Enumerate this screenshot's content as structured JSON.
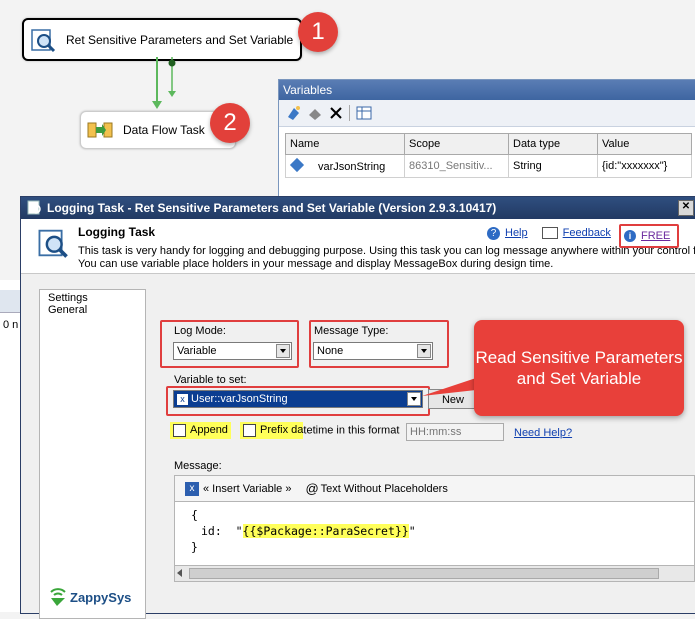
{
  "canvas": {
    "task1_label": "Ret Sensitive Parameters and Set Variable",
    "task2_label": "Data Flow Task",
    "badge1": "1",
    "badge2": "2"
  },
  "variables_window": {
    "title": "Variables",
    "columns": [
      "Name",
      "Scope",
      "Data type",
      "Value"
    ],
    "row": {
      "name": "varJsonString",
      "scope": "86310_Sensitiv...",
      "type": "String",
      "value": "{id:\"xxxxxxx\"}"
    }
  },
  "left_fragment": {
    "text": "0 n"
  },
  "dialog": {
    "title": "Logging Task - Ret Sensitive Parameters and Set Variable (Version 2.9.3.10417)",
    "header": {
      "heading": "Logging Task",
      "desc1": "This task is very handy for logging and debugging purpose. Using this task you can log message anywhere within your control flo",
      "desc2": "You can use variable place holders in your message and display MessageBox during design time.",
      "help": "Help",
      "feedback": "Feedback",
      "free": "FREE"
    },
    "nav": [
      "Settings",
      "General"
    ],
    "log_mode_label": "Log Mode:",
    "log_mode_value": "Variable",
    "message_type_label": "Message Type:",
    "message_type_value": "None",
    "variable_to_set_label": "Variable to set:",
    "variable_to_set_value": "User::varJsonString",
    "new_button": "New",
    "append_label": "Append",
    "prefix_label_a": "Prefix da",
    "prefix_label_b": "tetime in this format",
    "date_format_placeholder": "HH:mm:ss",
    "need_help": "Need Help?",
    "message_label": "Message:",
    "insert_variable": "« Insert Variable »",
    "text_without_placeholders": "Text Without Placeholders",
    "code_line1": "{",
    "code_line2_prefix": "id:  \"",
    "code_line2_highlight": "{{$Package::ParaSecret}}",
    "code_line2_suffix": "\"",
    "code_line3": "}",
    "brand": "ZappySys"
  },
  "callout": "Read Sensitive Parameters and Set Variable",
  "colors": {
    "annotation_red": "#e03e3e",
    "highlight_yellow": "#ffff5a",
    "title_bar": "#2f4e7f"
  }
}
